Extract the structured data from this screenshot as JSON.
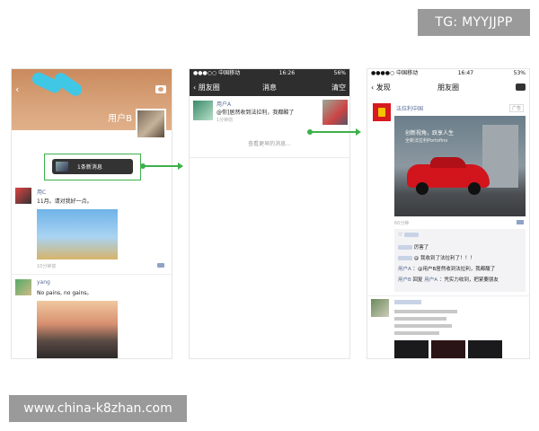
{
  "watermarks": {
    "top": "TG: MYYJJPP",
    "bottom": "www.china-k8zhan.com"
  },
  "phone1": {
    "username": "用户B",
    "new_message_notice": "1条新消息",
    "posts": [
      {
        "name": "用C",
        "text": "11月。请对我好一点。",
        "time": "10分钟前"
      },
      {
        "name": "yang",
        "text": "No pains, no gains。",
        "time": ""
      }
    ]
  },
  "phone2": {
    "status": {
      "carrier": "●●●○○ 中国移动",
      "time": "16:26",
      "battery": "56%"
    },
    "back_label": "朋友圈",
    "title": "消息",
    "clear_label": "清空",
    "message": {
      "name": "用户A",
      "text": "@你]居然收到法拉利，我都酸了",
      "time": "1分钟前"
    },
    "view_earlier": "查看更早的消息..."
  },
  "phone3": {
    "status": {
      "carrier": "●●●●○ 中国移动",
      "time": "16:47",
      "battery": "53%"
    },
    "back_label": "发现",
    "title": "朋友圈",
    "ad": {
      "name": "法拉利中国",
      "tag": "广告",
      "slogan1": "创新视角，跃享人生",
      "slogan2": "全新法拉利Portofino",
      "time": "60分钟"
    },
    "comments": {
      "c1": "厉害了",
      "c2": "@        我收到了法拉利了！！！",
      "c3_name": "用户A",
      "c3": "：@用户B居然收到法拉利，我都酸了",
      "c4_name": "用户B",
      "c4_mid": "回复",
      "c4_name2": "用户A",
      "c4": "：凭实力收到，把紧要朋友"
    }
  }
}
